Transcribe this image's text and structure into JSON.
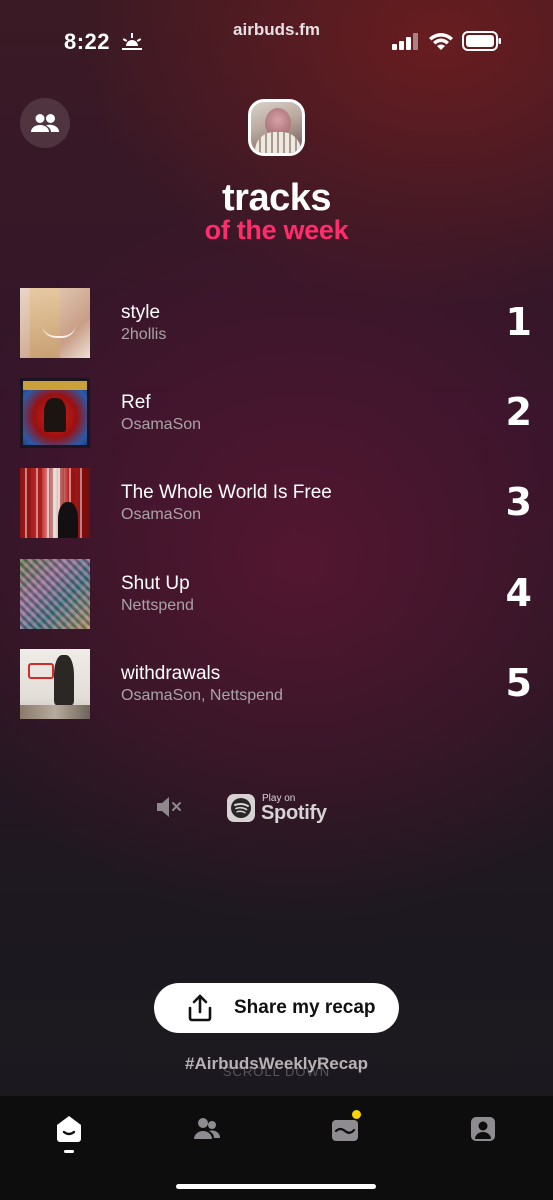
{
  "status_bar": {
    "time": "8:22",
    "url": "airbuds.fm",
    "icons": [
      "sun-horizon-icon",
      "signal-icon",
      "wifi-icon",
      "battery-icon"
    ]
  },
  "header": {
    "title": "tracks",
    "subtitle": "of the week",
    "subtitle_color": "#ff2d6b"
  },
  "tracks": [
    {
      "rank": "1",
      "name": "style",
      "artist": "2hollis"
    },
    {
      "rank": "2",
      "name": "Ref",
      "artist": "OsamaSon"
    },
    {
      "rank": "3",
      "name": "The Whole World Is Free",
      "artist": "OsamaSon"
    },
    {
      "rank": "4",
      "name": "Shut Up",
      "artist": "Nettspend"
    },
    {
      "rank": "5",
      "name": "withdrawals",
      "artist": "OsamaSon, Nettspend"
    }
  ],
  "player": {
    "spotify_small": "Play on",
    "spotify_big": "Spotify"
  },
  "share": {
    "label": "Share my recap",
    "hashtag": "#AirbudsWeeklyRecap",
    "scroll_hint": "SCROLL DOWN"
  },
  "tabbar": {
    "tabs": [
      "home-icon",
      "friends-icon",
      "inbox-icon",
      "profile-icon"
    ],
    "notification_color": "#f5d400"
  }
}
